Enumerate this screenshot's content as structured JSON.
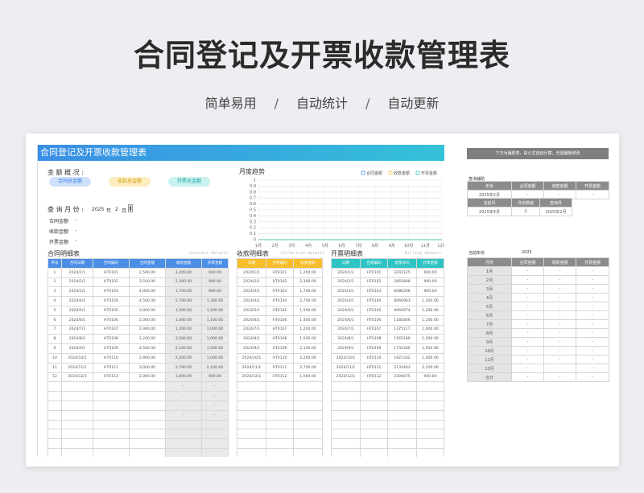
{
  "hero": {
    "title": "合同登记及开票收款管理表",
    "features": [
      "简单易用",
      "自动统计",
      "自动更新"
    ],
    "sep": "/"
  },
  "sheet": {
    "banner": "合同登记及开票收款管理表",
    "overview_label": "金 额 概 况 :",
    "pills": [
      {
        "label": "合同总金额",
        "bg": "#cfe0fb",
        "fg": "#3a7be0"
      },
      {
        "label": "收款总金额",
        "bg": "#fdedbf",
        "fg": "#d19a12"
      },
      {
        "label": "开票总金额",
        "bg": "#c8f1ef",
        "fg": "#1ea8a2"
      }
    ],
    "query_label": "查 询 月 份 :",
    "query_year": "2025",
    "query_year_unit": "年",
    "query_month": "2",
    "query_month_unit": "月",
    "summary_rows": [
      {
        "label": "合同金额",
        "value": "-"
      },
      {
        "label": "收款金额",
        "value": "-"
      },
      {
        "label": "开票金额",
        "value": "-"
      }
    ],
    "chart_data": {
      "type": "line",
      "title": "月度趋势",
      "categories": [
        "1月",
        "2月",
        "3月",
        "4月",
        "5月",
        "6月",
        "7月",
        "8月",
        "9月",
        "10月",
        "11月",
        "12月"
      ],
      "series": [
        {
          "name": "合同金额",
          "color": "#4a8ee8",
          "values": [
            0,
            0,
            0,
            0,
            0,
            0,
            0,
            0,
            0,
            0,
            0,
            0
          ]
        },
        {
          "name": "收款金额",
          "color": "#f7bd2a",
          "values": [
            0,
            0,
            0,
            0,
            0,
            0,
            0,
            0,
            0,
            0,
            0,
            0
          ]
        },
        {
          "name": "开票金额",
          "color": "#2ec4c4",
          "values": [
            0,
            0,
            0,
            0,
            0,
            0,
            0,
            0,
            0,
            0,
            0,
            0
          ]
        }
      ],
      "yticks": [
        "0",
        "0.1",
        "0.2",
        "0.3",
        "0.4",
        "0.5",
        "0.6",
        "0.7",
        "0.8",
        "0.9",
        "1"
      ],
      "ylim": [
        0,
        1
      ],
      "grid": true,
      "legend": "top-right"
    },
    "contract": {
      "title": "合同明细表",
      "en": "Contract details",
      "headers": [
        "序号",
        "合同日期",
        "合同编码",
        "合同金额",
        "收款金额",
        "开票金额"
      ],
      "rows": [
        [
          "1",
          "2024/1/1",
          "HT0101",
          "2,500.00",
          "1,200.00",
          "600.00"
        ],
        [
          "2",
          "2024/2/1",
          "HT0102",
          "3,500.00",
          "2,300.00",
          "900.00"
        ],
        [
          "3",
          "2024/3/1",
          "HT0103",
          "4,000.00",
          "1,700.00",
          "900.00"
        ],
        [
          "4",
          "2024/4/1",
          "HT0104",
          "4,500.00",
          "2,700.00",
          "1,300.00"
        ],
        [
          "5",
          "2024/5/1",
          "HT0105",
          "3,000.00",
          "1,500.00",
          "1,200.00"
        ],
        [
          "6",
          "2024/6/1",
          "HT0106",
          "2,000.00",
          "1,400.00",
          "1,100.00"
        ],
        [
          "7",
          "2024/7/1",
          "HT0107",
          "2,900.00",
          "1,200.00",
          "1,000.00"
        ],
        [
          "8",
          "2024/8/1",
          "HT0108",
          "3,200.00",
          "1,500.00",
          "1,000.00"
        ],
        [
          "9",
          "2024/9/1",
          "HT0109",
          "4,500.00",
          "2,100.00",
          "1,500.00"
        ],
        [
          "10",
          "2024/10/1",
          "HT0110",
          "2,900.00",
          "2,200.00",
          "1,000.00"
        ],
        [
          "11",
          "2024/11/1",
          "HT0111",
          "3,000.00",
          "2,700.00",
          "2,100.00"
        ],
        [
          "12",
          "2024/12/1",
          "HT0112",
          "2,000.00",
          "1,000.00",
          "900.00"
        ]
      ],
      "dash": "-"
    },
    "collection": {
      "title": "收款明细表",
      "en": "Collection details",
      "headers": [
        "日期",
        "合同编码",
        "收款金额"
      ],
      "rows": [
        [
          "2024/1/1",
          "HT0101",
          "1,200.00"
        ],
        [
          "2024/2/1",
          "HT0102",
          "2,300.00"
        ],
        [
          "2024/3/1",
          "HT0103",
          "1,700.00"
        ],
        [
          "2024/4/1",
          "HT0104",
          "2,700.00"
        ],
        [
          "2024/5/1",
          "HT0105",
          "1,500.00"
        ],
        [
          "2024/6/1",
          "HT0106",
          "1,400.00"
        ],
        [
          "2024/7/1",
          "HT0107",
          "1,200.00"
        ],
        [
          "2024/8/1",
          "HT0108",
          "1,500.00"
        ],
        [
          "2024/9/1",
          "HT0109",
          "2,100.00"
        ],
        [
          "2024/10/1",
          "HT0110",
          "2,200.00"
        ],
        [
          "2024/11/1",
          "HT0111",
          "2,700.00"
        ],
        [
          "2024/12/1",
          "HT0112",
          "1,000.00"
        ]
      ]
    },
    "billing": {
      "title": "开票明细表",
      "en": "Billing details",
      "headers": [
        "日期",
        "合同编码",
        "发票号码",
        "开票金额"
      ],
      "rows": [
        [
          "2024/1/1",
          "HT0101",
          "3202125",
          "600.00"
        ],
        [
          "2024/2/1",
          "HT0102",
          "2665808",
          "900.00"
        ],
        [
          "2024/3/1",
          "HT0103",
          "6086268",
          "900.00"
        ],
        [
          "2024/4/1",
          "HT0104",
          "8066963",
          "1,300.00"
        ],
        [
          "2024/5/1",
          "HT0105",
          "9966974",
          "1,200.00"
        ],
        [
          "2024/6/1",
          "HT0106",
          "1185846",
          "1,100.00"
        ],
        [
          "2024/7/1",
          "HT0107",
          "1375117",
          "1,000.00"
        ],
        [
          "2024/8/1",
          "HT0108",
          "1565189",
          "1,000.00"
        ],
        [
          "2024/9/1",
          "HT0109",
          "1732260",
          "1,500.00"
        ],
        [
          "2024/10/1",
          "HT0110",
          "1921332",
          "1,000.00"
        ],
        [
          "2024/11/1",
          "HT0111",
          "2133403",
          "2,100.00"
        ],
        [
          "2024/12/1",
          "HT0112",
          "2309475",
          "900.00"
        ]
      ]
    }
  },
  "right": {
    "bar_text": "下方为辅助表，由公式自动计算，无需编辑修改",
    "query_aux_label": "查询辅助",
    "aux_headers": [
      "年份",
      "合同金额",
      "收款金额",
      "开票金额"
    ],
    "aux_row": [
      "2025年2月",
      "-",
      "-",
      "-"
    ],
    "cur_headers": [
      "当前月",
      "月份数值",
      "查询月"
    ],
    "cur_row": [
      "2025年4月",
      "2",
      "2025年2月"
    ],
    "year_label": "当前年份",
    "year_value": "2025",
    "month_headers": [
      "月份",
      "合同金额",
      "收款金额",
      "开票金额"
    ],
    "months": [
      "1月",
      "2月",
      "3月",
      "4月",
      "5月",
      "6月",
      "7月",
      "8月",
      "9月",
      "10月",
      "11月",
      "12月",
      "合计"
    ],
    "dash": "-"
  }
}
